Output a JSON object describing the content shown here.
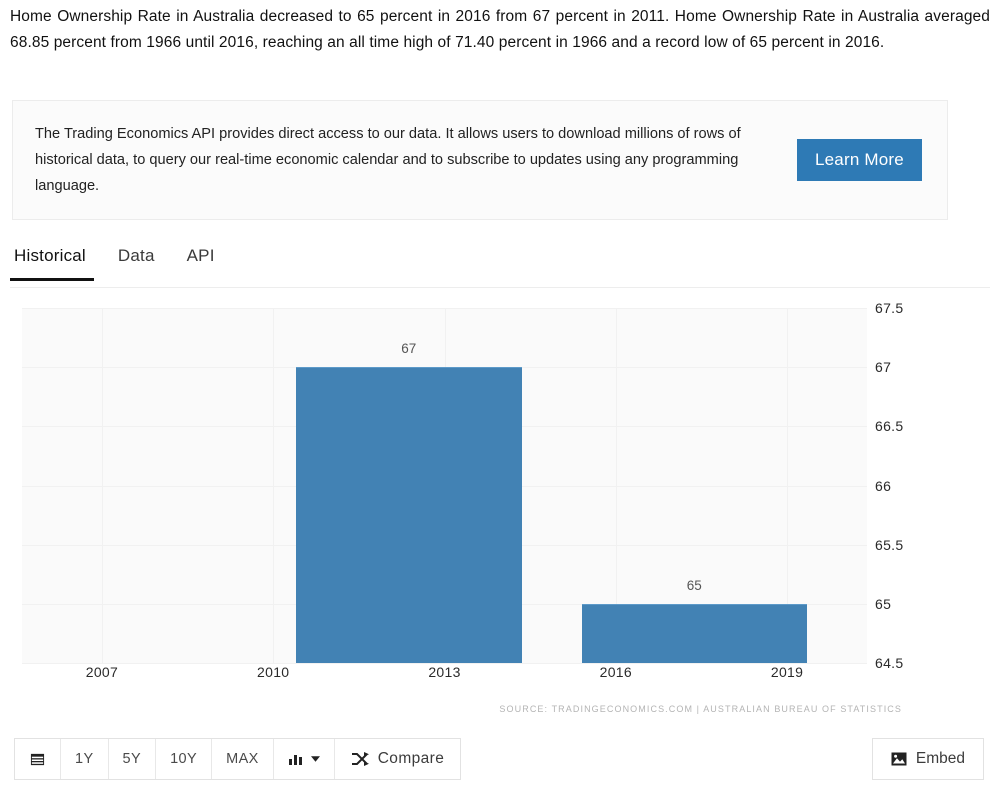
{
  "intro": {
    "paragraph": "Home Ownership Rate in Australia decreased to 65 percent in 2016 from 67 percent in 2011. Home Ownership Rate in Australia averaged 68.85 percent from 1966 until 2016, reaching an all time high of 71.40 percent in 1966 and a record low of 65 percent in 2016."
  },
  "api_promo": {
    "text": "The Trading Economics API provides direct access to our data. It allows users to download millions of rows of historical data, to query our real-time economic calendar and to subscribe to updates using any programming language.",
    "button_label": "Learn More",
    "button_color": "#2e7ab5"
  },
  "tabs": [
    {
      "label": "Historical",
      "active": true
    },
    {
      "label": "Data",
      "active": false
    },
    {
      "label": "API",
      "active": false
    }
  ],
  "chart_data": {
    "type": "bar",
    "title": "",
    "xlabel": "",
    "ylabel": "",
    "x": [
      2011,
      2016
    ],
    "values": [
      67,
      65
    ],
    "data_labels": [
      "67",
      "65"
    ],
    "ylim": [
      64.5,
      67.5
    ],
    "yticks": [
      67.5,
      67,
      66.5,
      66,
      65.5,
      65,
      64.5
    ],
    "ytick_labels": [
      "67.5",
      "67",
      "66.5",
      "66",
      "65.5",
      "65",
      "64.5"
    ],
    "xtick_labels": [
      "2007",
      "2010",
      "2013",
      "2016",
      "2019"
    ],
    "xlim": [
      2005.6,
      2020.4
    ],
    "grid": true,
    "legend": "none",
    "bar_color": "#4282b4",
    "source": "SOURCE: TRADINGECONOMICS.COM  |  AUSTRALIAN BUREAU OF STATISTICS"
  },
  "toolbar": {
    "calendar_label": "",
    "ranges": [
      "1Y",
      "5Y",
      "10Y",
      "MAX"
    ],
    "chart_type_label": "",
    "compare_label": "Compare",
    "embed_label": "Embed"
  }
}
